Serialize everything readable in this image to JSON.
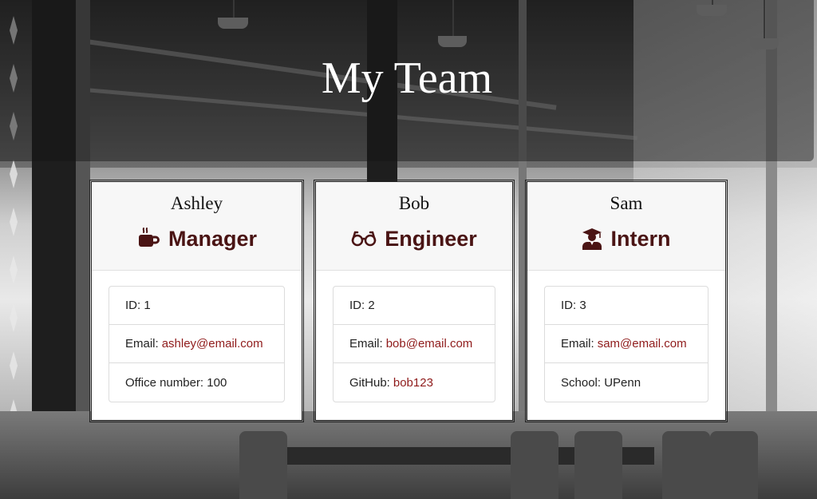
{
  "header": {
    "title": "My Team"
  },
  "theme": {
    "role_color": "#4a1414",
    "link_color": "#8f1b1b"
  },
  "cards": [
    {
      "name": "Ashley",
      "role": "Manager",
      "icon": "coffee-icon",
      "id_label": "ID:",
      "id_value": "1",
      "email_label": "Email:",
      "email_value": "ashley@email.com",
      "extra_label": "Office number:",
      "extra_value": "100"
    },
    {
      "name": "Bob",
      "role": "Engineer",
      "icon": "glasses-icon",
      "id_label": "ID:",
      "id_value": "2",
      "email_label": "Email:",
      "email_value": "bob@email.com",
      "extra_label": "GitHub:",
      "extra_value": "bob123"
    },
    {
      "name": "Sam",
      "role": "Intern",
      "icon": "graduate-icon",
      "id_label": "ID:",
      "id_value": "3",
      "email_label": "Email:",
      "email_value": "sam@email.com",
      "extra_label": "School:",
      "extra_value": "UPenn"
    }
  ]
}
